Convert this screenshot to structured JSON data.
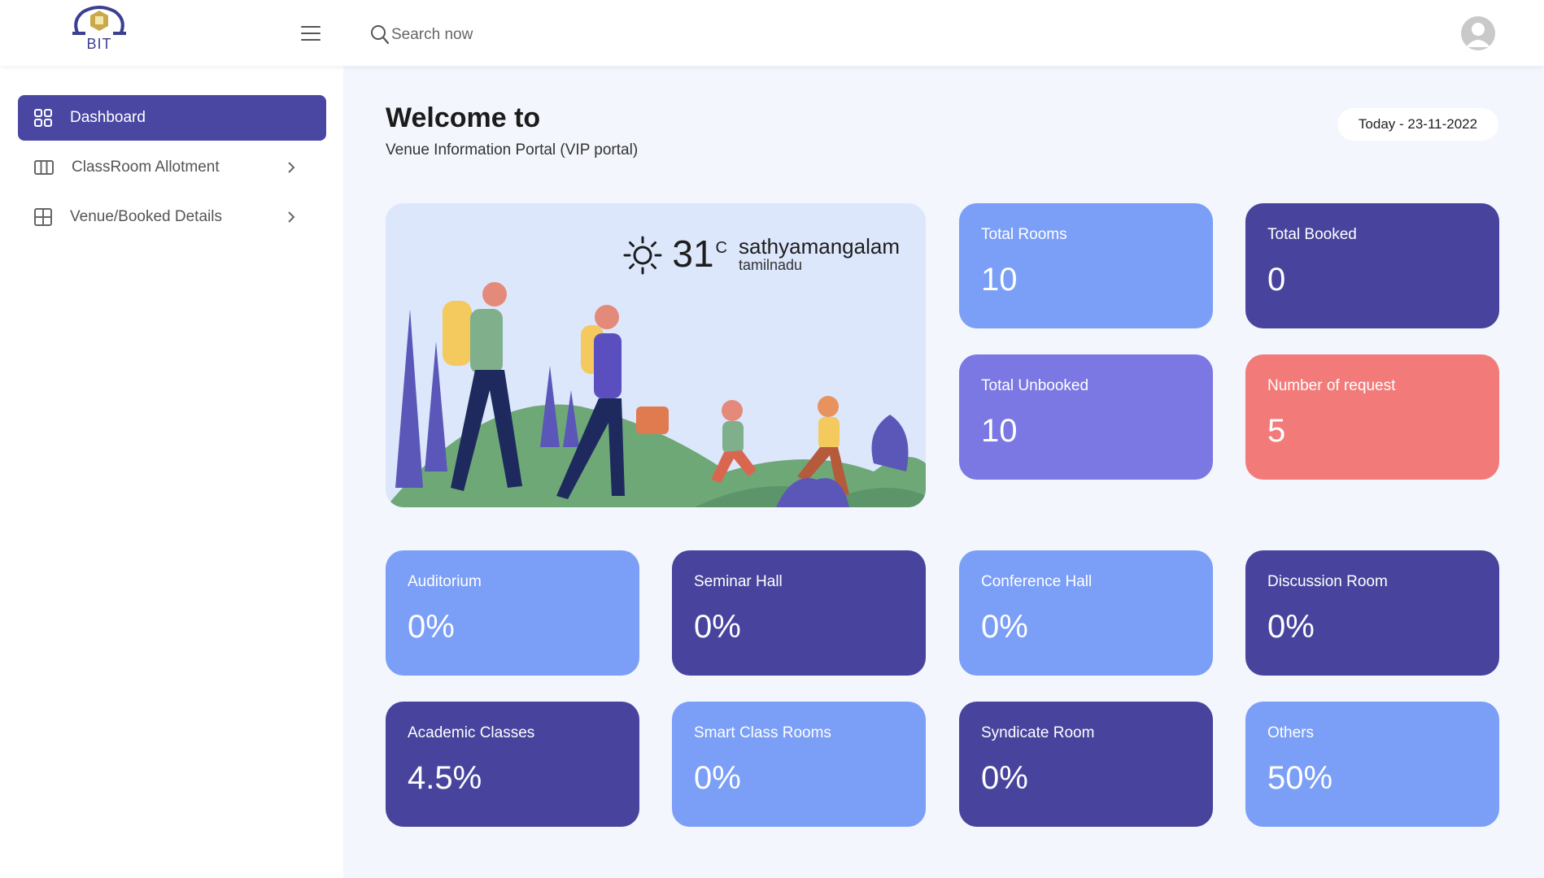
{
  "header": {
    "logo_text": "BIT",
    "search_placeholder": "Search now"
  },
  "sidebar": {
    "items": [
      {
        "label": "Dashboard",
        "icon": "grid-icon",
        "active": true
      },
      {
        "label": "ClassRoom Allotment",
        "icon": "columns-icon",
        "active": false
      },
      {
        "label": "Venue/Booked Details",
        "icon": "table-icon",
        "active": false
      }
    ]
  },
  "welcome": {
    "title": "Welcome to",
    "subtitle": "Venue Information Portal (VIP portal)",
    "date": "Today - 23-11-2022"
  },
  "weather": {
    "temperature": "31",
    "unit": "C",
    "city": "sathyamangalam",
    "state": "tamilnadu",
    "icon": "sun-icon"
  },
  "stats": [
    {
      "label": "Total Rooms",
      "value": "10"
    },
    {
      "label": "Total Booked",
      "value": "0"
    },
    {
      "label": "Total Unbooked",
      "value": "10"
    },
    {
      "label": "Number of request",
      "value": "5"
    }
  ],
  "venues": [
    {
      "label": "Auditorium",
      "value": "0%"
    },
    {
      "label": "Seminar Hall",
      "value": "0%"
    },
    {
      "label": "Conference Hall",
      "value": "0%"
    },
    {
      "label": "Discussion Room",
      "value": "0%"
    },
    {
      "label": "Academic Classes",
      "value": "4.5%"
    },
    {
      "label": "Smart Class Rooms",
      "value": "0%"
    },
    {
      "label": "Syndicate Room",
      "value": "0%"
    },
    {
      "label": "Others",
      "value": "50%"
    }
  ],
  "colors": {
    "accent": "#4a47a3",
    "card_light": "#7b9ff7",
    "card_dark": "#48449d",
    "card_violet": "#7b78e3",
    "card_red": "#f27b7a"
  }
}
